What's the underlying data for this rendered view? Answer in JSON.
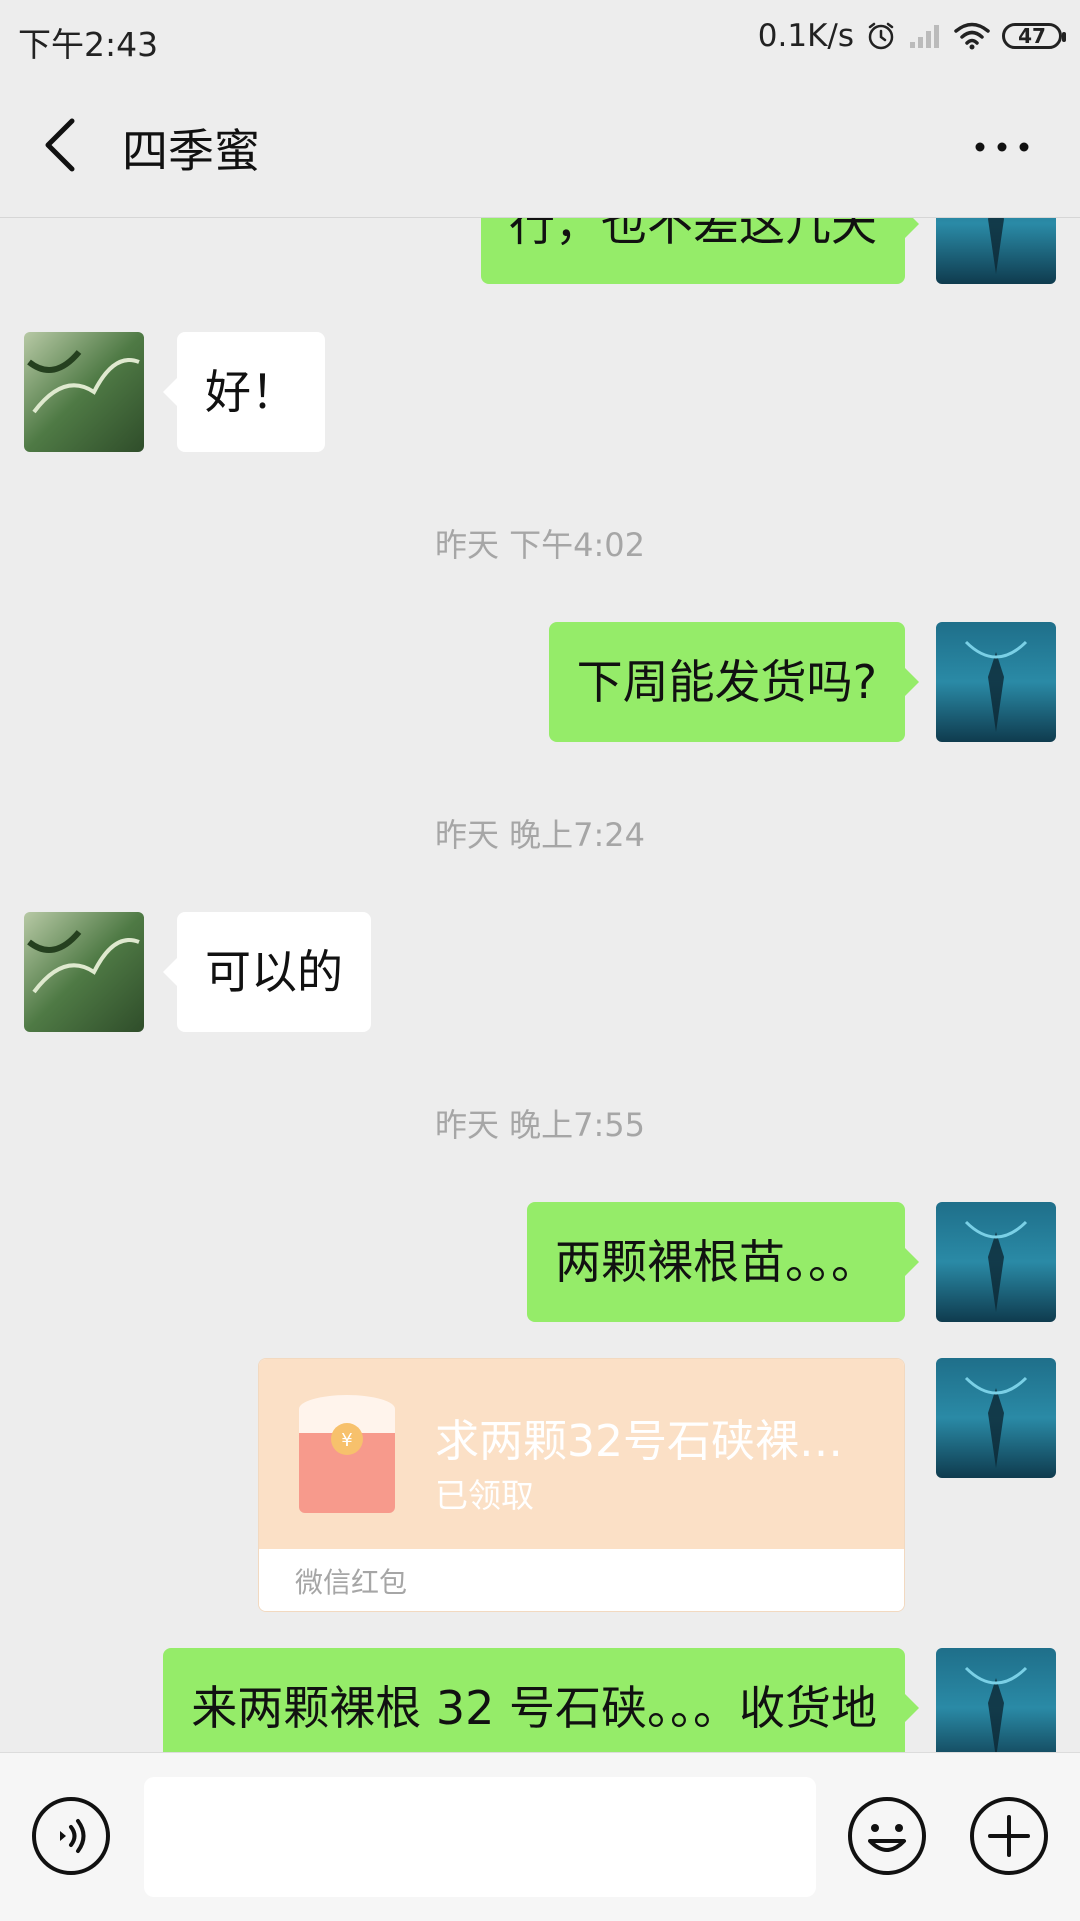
{
  "status": {
    "time": "下午2:43",
    "net_speed": "0.1K/s",
    "battery": "47",
    "icons": [
      "alarm-icon",
      "signal-icon",
      "wifi-icon",
      "battery-icon"
    ]
  },
  "header": {
    "title": "四季蜜",
    "back_icon": "back-arrow-icon",
    "more_icon": "more-dots-icon"
  },
  "messages": [
    {
      "side": "me",
      "text": "行，也不差这几天"
    },
    {
      "side": "them",
      "text": "好！"
    },
    {
      "type": "time",
      "text": "昨天 下午4:02"
    },
    {
      "side": "me",
      "text": "下周能发货吗?"
    },
    {
      "type": "time",
      "text": "昨天 晚上7:24"
    },
    {
      "side": "them",
      "text": "可以的"
    },
    {
      "type": "time",
      "text": "昨天 晚上7:55"
    },
    {
      "side": "me",
      "text": "两颗裸根苗。。。"
    },
    {
      "side": "me",
      "type": "red_packet",
      "title": "求两颗32号石硖裸…",
      "status": "已领取",
      "label": "微信红包"
    },
    {
      "side": "me",
      "text": "来两颗裸根 32 号石硖。。。收货地"
    }
  ],
  "input_bar": {
    "voice_icon": "voice-icon",
    "emoji_icon": "emoji-icon",
    "plus_icon": "plus-icon",
    "placeholder": ""
  },
  "colors": {
    "background": "#ededed",
    "my_bubble": "#95ec69",
    "their_bubble": "#ffffff",
    "red_packet": "#fbe0c6"
  }
}
